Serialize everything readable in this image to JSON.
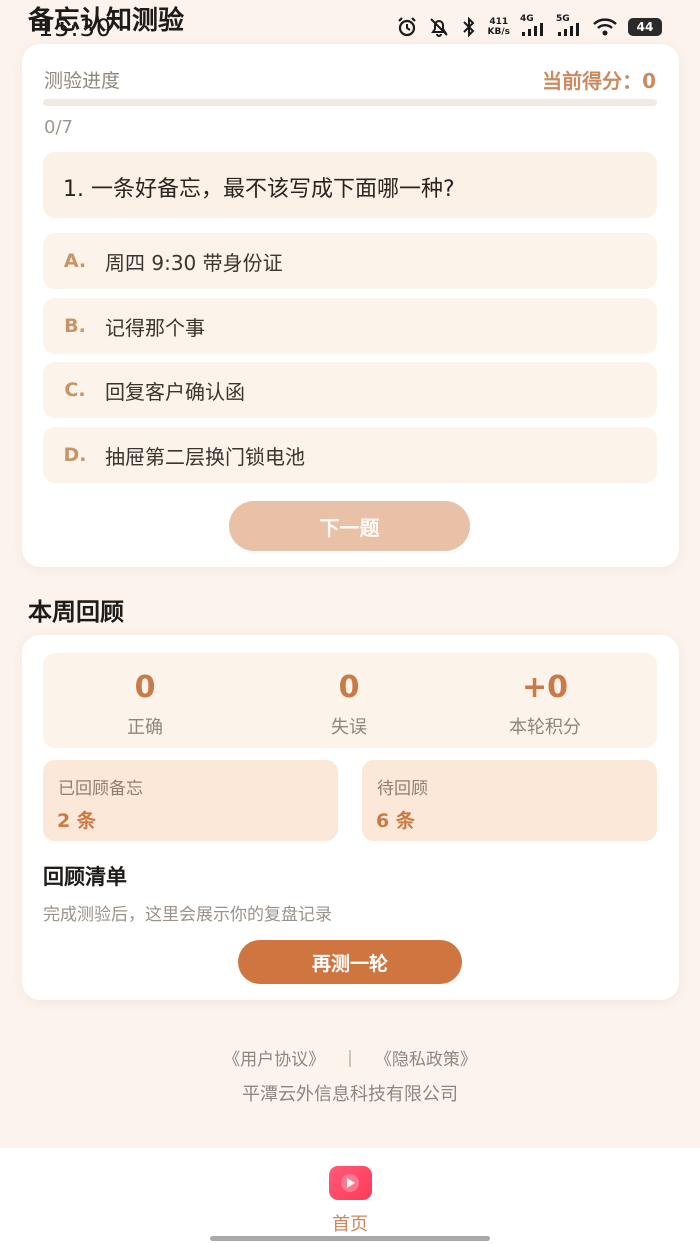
{
  "status_bar": {
    "time": "15:30",
    "net_speed_value": "411",
    "net_speed_unit": "KB/s",
    "signal_1": "4G",
    "signal_2": "5G",
    "battery": "44",
    "icons": [
      "alarm-icon",
      "bell-off-icon",
      "bluetooth-icon",
      "network-speed",
      "signal-4g-icon",
      "signal-5g-icon",
      "wifi-icon",
      "battery-icon"
    ]
  },
  "page": {
    "title": "备忘认知测验"
  },
  "quiz": {
    "progress_label": "测验进度",
    "score_label": "当前得分：0",
    "progress_count": "0/7",
    "progress_fraction": 0,
    "question": "1. 一条好备忘，最不该写成下面哪一种?",
    "options": [
      {
        "letter": "A.",
        "text": "周四 9:30 带身份证"
      },
      {
        "letter": "B.",
        "text": "记得那个事"
      },
      {
        "letter": "C.",
        "text": "回复客户确认函"
      },
      {
        "letter": "D.",
        "text": "抽屉第二层换门锁电池"
      }
    ],
    "next_button": "下一题"
  },
  "review": {
    "section_title": "本周回顾",
    "stats": [
      {
        "value": "0",
        "label": "正确"
      },
      {
        "value": "0",
        "label": "失误"
      },
      {
        "value": "+0",
        "label": "本轮积分"
      }
    ],
    "reviewed": {
      "label": "已回顾备忘",
      "value": "2 条"
    },
    "pending": {
      "label": "待回顾",
      "value": "6 条"
    },
    "list_title": "回顾清单",
    "list_desc": "完成测验后，这里会展示你的复盘记录",
    "retry_button": "再测一轮"
  },
  "footer": {
    "user_agreement": "《用户协议》",
    "separator": "|",
    "privacy_policy": "《隐私政策》",
    "company": "平潭云外信息科技有限公司"
  },
  "tabbar": {
    "home_label": "首页"
  },
  "colors": {
    "accent": "#cf7540",
    "background": "#fbf3ec",
    "option_bg": "#fcf3ea",
    "next_disabled": "#e9c1a7",
    "home_icon": "#ff3a56"
  }
}
